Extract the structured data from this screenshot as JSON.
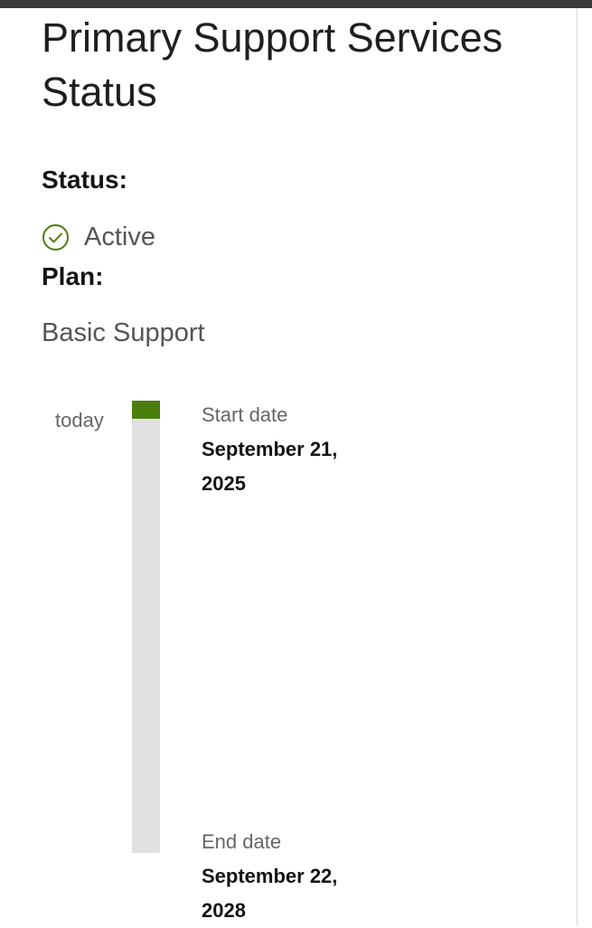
{
  "page": {
    "title": "Primary Support Services Status"
  },
  "status": {
    "label": "Status:",
    "value": "Active",
    "icon": "check-circle-icon",
    "color": "#4a7e0b"
  },
  "plan": {
    "label": "Plan:",
    "value": "Basic Support"
  },
  "timeline": {
    "today_label": "today",
    "progress_fraction": 0.04,
    "progress_color": "#4a7e0b",
    "track_color": "#e0e0e0",
    "start": {
      "caption": "Start date",
      "line1": "September 21,",
      "line2": "2025"
    },
    "end": {
      "caption": "End date",
      "line1": "September 22,",
      "line2": "2028"
    }
  }
}
